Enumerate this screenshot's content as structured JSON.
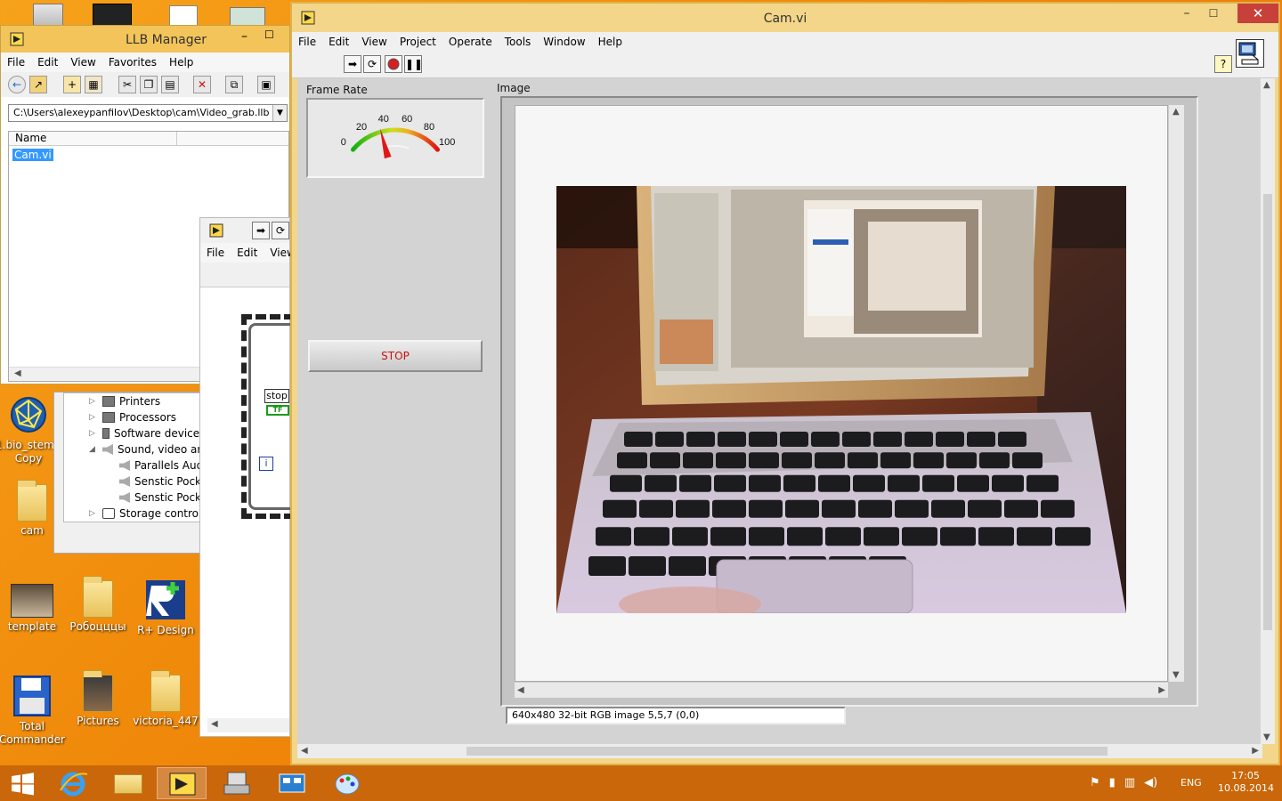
{
  "desktop": {
    "icons": [
      {
        "label": "1.bio_stem - Copy"
      },
      {
        "label": "cam"
      },
      {
        "label": "template"
      },
      {
        "label": "Робоцццы"
      },
      {
        "label": "R+ Design"
      },
      {
        "label": "Total Commander"
      },
      {
        "label": "Pictures"
      },
      {
        "label": "victoria_447"
      }
    ]
  },
  "llb_manager": {
    "title": "LLB Manager",
    "menu": [
      "File",
      "Edit",
      "View",
      "Favorites",
      "Help"
    ],
    "path": "C:\\Users\\alexeypanfilov\\Desktop\\cam\\Video_grab.llb",
    "column_name": "Name",
    "items": [
      {
        "label": "Cam.vi"
      }
    ]
  },
  "device_manager": {
    "rows": [
      {
        "label": "Printers"
      },
      {
        "label": "Processors"
      },
      {
        "label": "Software devices"
      },
      {
        "label": "Sound, video and"
      },
      {
        "label": "Parallels Aud"
      },
      {
        "label": "Senstic Pocke"
      },
      {
        "label": "Senstic Pocke"
      },
      {
        "label": "Storage controlle"
      }
    ]
  },
  "block_diagram": {
    "menu": [
      "File",
      "Edit",
      "View"
    ],
    "stop_label": "stop",
    "tf_label": "TF",
    "iter_label": "i"
  },
  "cam_vi": {
    "title": "Cam.vi",
    "menu": [
      "File",
      "Edit",
      "View",
      "Project",
      "Operate",
      "Tools",
      "Window",
      "Help"
    ],
    "help_glyph": "?",
    "frame_rate": {
      "label": "Frame Rate",
      "ticks": [
        "0",
        "20",
        "40",
        "60",
        "80",
        "100"
      ],
      "min": 0,
      "max": 100,
      "value": 35
    },
    "stop_button": "STOP",
    "image_label": "Image",
    "image_info": "640x480 32-bit RGB image 5,5,7    (0,0)"
  },
  "taskbar": {
    "lang": "ENG",
    "time": "17:05",
    "date": "10.08.2014"
  }
}
